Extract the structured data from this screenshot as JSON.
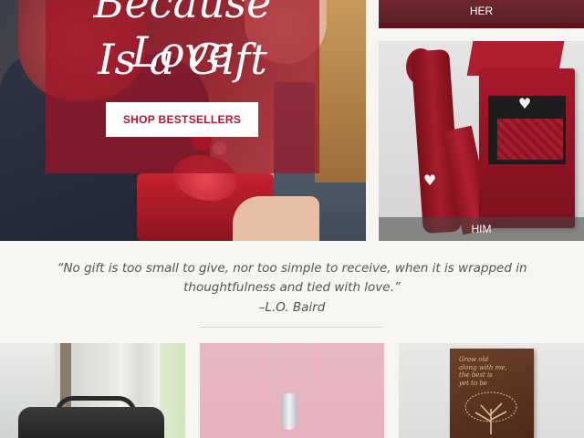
{
  "hero": {
    "title_line1": "Because Love",
    "title_line2": "Is a Gift",
    "cta_label": "SHOP BESTSELLERS"
  },
  "tiles": {
    "her_label": "HER",
    "him_label": "HIM"
  },
  "quote": {
    "text": "“No gift is too small to give, nor too simple to receive, when it is wrapped in thoughtfulness and tied with love.”",
    "author": "–L.O. Baird"
  },
  "products": {
    "plaque_text": "Grow old\nalong with me,\nthe best is\nyet to be"
  },
  "colors": {
    "brand_red": "#a01426",
    "button_text": "#b0182b",
    "background": "#f6f5f2"
  }
}
